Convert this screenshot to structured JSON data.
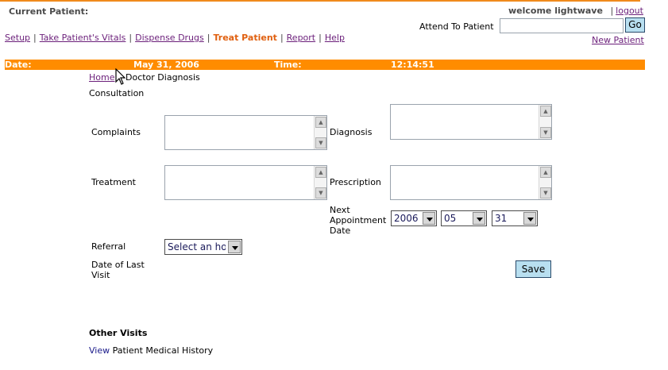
{
  "header": {
    "current_patient_label": "Current Patient:",
    "welcome_text": "welcome lightwave",
    "logout_sep": "|",
    "logout_label": "logout",
    "attend_label": "Attend To Patient",
    "attend_value": "",
    "go_label": "Go",
    "new_patient_label": "New Patient"
  },
  "nav": {
    "items": [
      {
        "label": "Setup"
      },
      {
        "label": "Take Patient's Vitals"
      },
      {
        "label": "Dispense Drugs"
      },
      {
        "label": "Treat Patient"
      },
      {
        "label": "Report"
      },
      {
        "label": "Help"
      }
    ],
    "separator": "|",
    "active_index": 3
  },
  "status_bar": {
    "date_label": "Date:",
    "date_value": "May 31, 2006",
    "time_label": "Time:",
    "time_value": "12:14:51",
    "color": "#ff8c00"
  },
  "breadcrumb": {
    "home_label": "Home",
    "current": "Doctor Diagnosis"
  },
  "form": {
    "section_title": "Consultation",
    "complaints_label": "Complaints",
    "complaints_value": "",
    "diagnosis_label": "Diagnosis",
    "diagnosis_value": "",
    "treatment_label": "Treatment",
    "treatment_value": "",
    "prescription_label": "Prescription",
    "prescription_value": "",
    "next_appt_label_1": "Next",
    "next_appt_label_2": "Appointment",
    "next_appt_label_3": "Date",
    "year_value": "2006",
    "month_value": "05",
    "day_value": "31",
    "referral_label": "Referral",
    "referral_value": "Select an hospital",
    "last_visit_label_1": "Date of Last",
    "last_visit_label_2": "Visit",
    "save_label": "Save"
  },
  "other_visits": {
    "title": "Other Visits",
    "view_link": "View",
    "history_text": "Patient Medical History"
  }
}
